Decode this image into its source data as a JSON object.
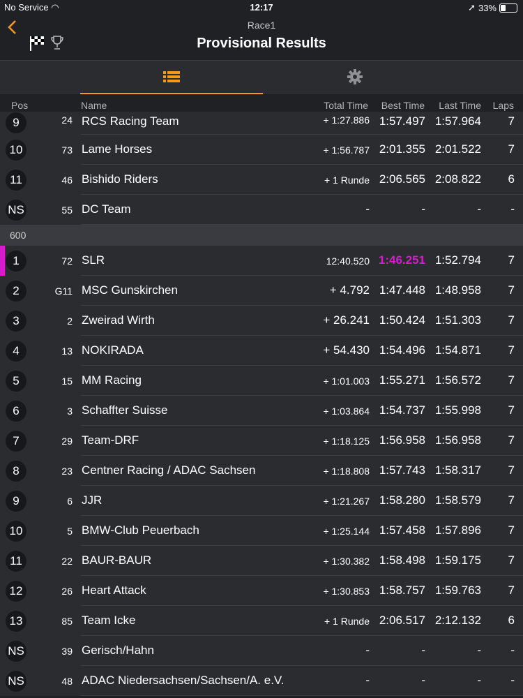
{
  "status_bar": {
    "carrier": "No Service",
    "time": "12:17",
    "battery": "33%"
  },
  "header": {
    "subtitle": "Race1",
    "title": "Provisional Results"
  },
  "columns": {
    "pos": "Pos",
    "name": "Name",
    "total": "Total Time",
    "best": "Best Time",
    "last": "Last Time",
    "laps": "Laps"
  },
  "groupA": [
    {
      "pos": "9",
      "num": "24",
      "name": "RCS Racing Team",
      "total": "+ 1:27.886",
      "best": "1:57.497",
      "last": "1:57.964",
      "laps": "7"
    },
    {
      "pos": "10",
      "num": "73",
      "name": "Lame Horses",
      "total": "+ 1:56.787",
      "best": "2:01.355",
      "last": "2:01.522",
      "laps": "7"
    },
    {
      "pos": "11",
      "num": "46",
      "name": "Bishido Riders",
      "total": "+ 1 Runde",
      "best": "2:06.565",
      "last": "2:08.822",
      "laps": "6"
    },
    {
      "pos": "NS",
      "num": "55",
      "name": "DC Team",
      "total": "-",
      "best": "-",
      "last": "-",
      "laps": "-"
    }
  ],
  "section": {
    "label": "600"
  },
  "groupB": [
    {
      "pos": "1",
      "num": "72",
      "name": "SLR",
      "total": "12:40.520",
      "best": "1:46.251",
      "last": "1:52.794",
      "laps": "7"
    },
    {
      "pos": "2",
      "num": "G11",
      "name": "MSC Gunskirchen",
      "total": "+ 4.792",
      "best": "1:47.448",
      "last": "1:48.958",
      "laps": "7"
    },
    {
      "pos": "3",
      "num": "2",
      "name": "Zweirad Wirth",
      "total": "+ 26.241",
      "best": "1:50.424",
      "last": "1:51.303",
      "laps": "7"
    },
    {
      "pos": "4",
      "num": "13",
      "name": "NOKIRADA",
      "total": "+ 54.430",
      "best": "1:54.496",
      "last": "1:54.871",
      "laps": "7"
    },
    {
      "pos": "5",
      "num": "15",
      "name": "MM Racing",
      "total": "+ 1:01.003",
      "best": "1:55.271",
      "last": "1:56.572",
      "laps": "7"
    },
    {
      "pos": "6",
      "num": "3",
      "name": "Schaffter Suisse",
      "total": "+ 1:03.864",
      "best": "1:54.737",
      "last": "1:55.998",
      "laps": "7"
    },
    {
      "pos": "7",
      "num": "29",
      "name": "Team-DRF",
      "total": "+ 1:18.125",
      "best": "1:56.958",
      "last": "1:56.958",
      "laps": "7"
    },
    {
      "pos": "8",
      "num": "23",
      "name": "Centner Racing / ADAC Sachsen",
      "total": "+ 1:18.808",
      "best": "1:57.743",
      "last": "1:58.317",
      "laps": "7"
    },
    {
      "pos": "9",
      "num": "6",
      "name": "JJR",
      "total": "+ 1:21.267",
      "best": "1:58.280",
      "last": "1:58.579",
      "laps": "7"
    },
    {
      "pos": "10",
      "num": "5",
      "name": "BMW-Club Peuerbach",
      "total": "+ 1:25.144",
      "best": "1:57.458",
      "last": "1:57.896",
      "laps": "7"
    },
    {
      "pos": "11",
      "num": "22",
      "name": "BAUR-BAUR",
      "total": "+ 1:30.382",
      "best": "1:58.498",
      "last": "1:59.175",
      "laps": "7"
    },
    {
      "pos": "12",
      "num": "26",
      "name": "Heart Attack",
      "total": "+ 1:30.853",
      "best": "1:58.757",
      "last": "1:59.763",
      "laps": "7"
    },
    {
      "pos": "13",
      "num": "85",
      "name": "Team Icke",
      "total": "+ 1 Runde",
      "best": "2:06.517",
      "last": "2:12.132",
      "laps": "6"
    },
    {
      "pos": "NS",
      "num": "39",
      "name": "Gerisch/Hahn",
      "total": "-",
      "best": "-",
      "last": "-",
      "laps": "-"
    },
    {
      "pos": "NS",
      "num": "48",
      "name": "ADAC Niedersachsen/Sachsen/A. e.V.",
      "total": "-",
      "best": "-",
      "last": "-",
      "laps": "-"
    }
  ],
  "colors": {
    "accent": "#f59b18",
    "highlight": "#d61ccf"
  }
}
